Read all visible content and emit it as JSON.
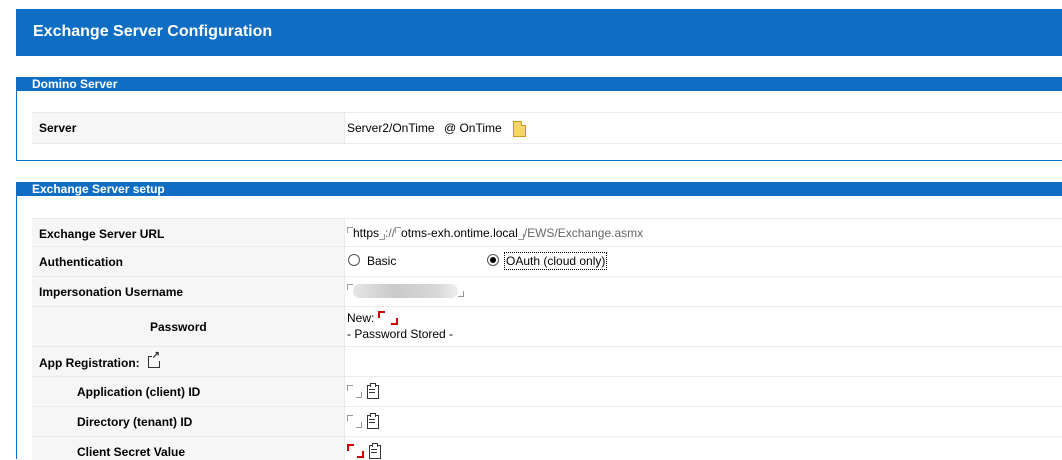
{
  "page": {
    "title": "Exchange Server Configuration"
  },
  "domino": {
    "header": "Domino Server",
    "server_label": "Server",
    "server_value": "Server2/OnTime",
    "server_domain": "@ OnTime"
  },
  "exchange": {
    "header": "Exchange Server setup",
    "url_label": "Exchange Server URL",
    "url_protocol": "https",
    "url_sep": "://",
    "url_host": "otms-exh.ontime.local",
    "url_path": "/EWS/Exchange.asmx",
    "auth_label": "Authentication",
    "auth_basic": "Basic",
    "auth_oauth": "OAuth (cloud only)",
    "auth_selected": "OAuth (cloud only)",
    "imp_label": "Impersonation Username",
    "password_label": "Password",
    "password_new": "New:",
    "password_stored": "- Password Stored -",
    "appreg_label": "App Registration:",
    "client_id_label": "Application (client) ID",
    "tenant_id_label": "Directory (tenant) ID",
    "secret_label": "Client Secret Value"
  },
  "colors": {
    "accent": "#0f6ec4",
    "required": "#cc0000"
  },
  "icons": {
    "server_doc": "document-icon",
    "appreg_link": "external-link-icon",
    "paste": "paste-icon"
  }
}
